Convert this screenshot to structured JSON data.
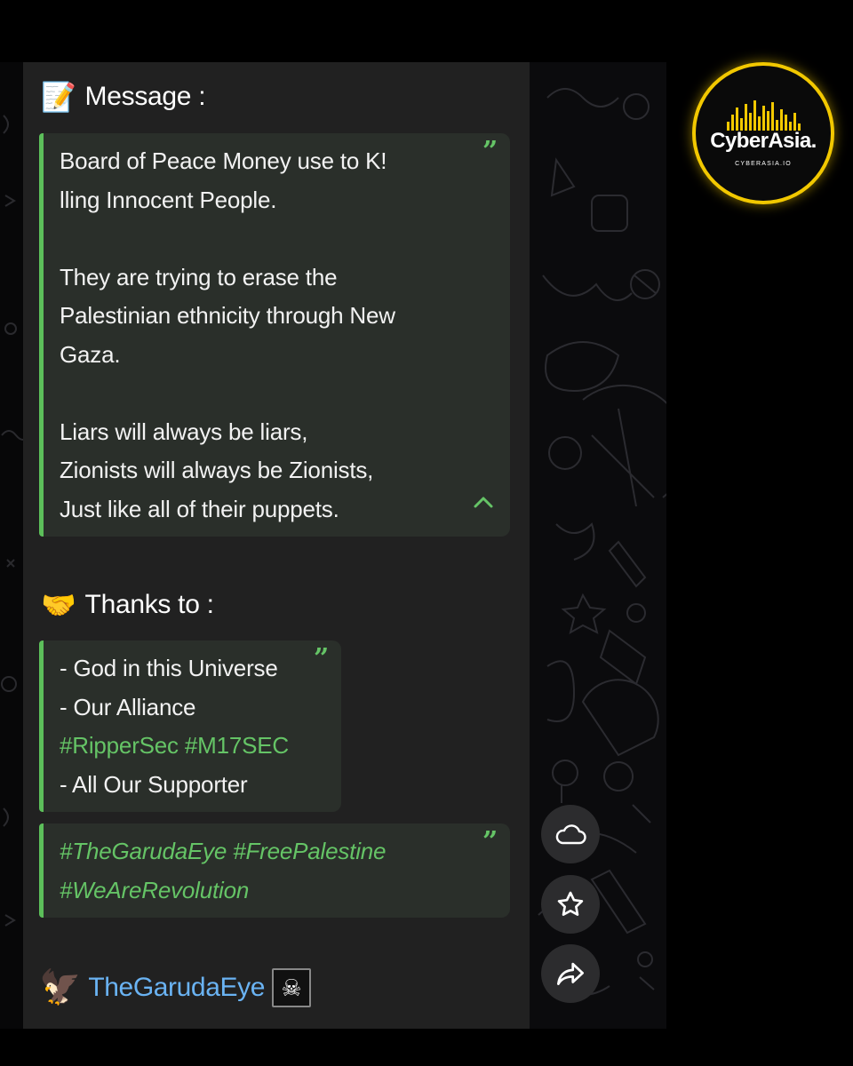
{
  "message_section": {
    "emoji": "📝",
    "title": "Message :",
    "lines": [
      "Board of Peace Money use to K!",
      "lling Innocent People.",
      "",
      "They are trying to erase the",
      "Palestinian ethnicity through New",
      "Gaza.",
      "",
      "Liars will always be liars,",
      "Zionists will always be Zionists,",
      "Just like all of their puppets."
    ]
  },
  "thanks_section": {
    "emoji": "🤝",
    "title": "Thanks to :",
    "lines": [
      "- God in this Universe",
      "- Our Alliance",
      "#RipperSec #M17SEC",
      "- All Our Supporter"
    ]
  },
  "hashtag_quote": {
    "lines": [
      "#TheGarudaEye #FreePalestine",
      "#WeAreRevolution"
    ]
  },
  "signature": {
    "emoji": "🦅",
    "name": "TheGarudaEye",
    "flag": "🏴‍☠️"
  },
  "logo": {
    "brand": "CyberAsia.",
    "site": "CYBERASIA.IO",
    "accent_color": "#f2c800"
  },
  "colors": {
    "quote_accent": "#5cbf5a",
    "hashtag": "#65c466",
    "link_name": "#6ab3f3",
    "card_bg": "#212121"
  },
  "icons": {
    "quote": "quote-icon",
    "collapse": "chevron-up-icon",
    "side_buttons": [
      "cloud-icon",
      "star-icon",
      "share-icon"
    ]
  }
}
